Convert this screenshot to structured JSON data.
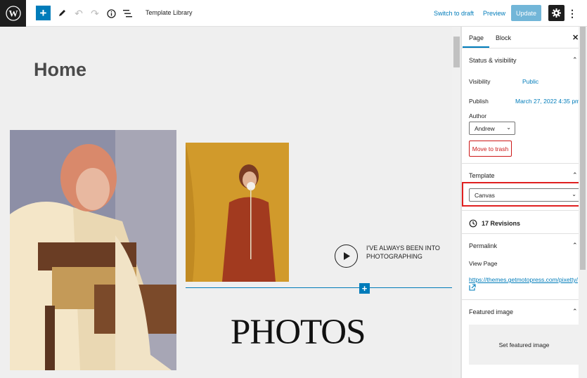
{
  "topbar": {
    "document_title": "Template Library",
    "switch_to_draft": "Switch to draft",
    "preview": "Preview",
    "update": "Update"
  },
  "canvas": {
    "page_title": "Home",
    "play_text": "I'VE ALWAYS BEEN INTO PHOTOGRAPHING",
    "photos_heading": "PHOTOS"
  },
  "sidebar": {
    "tabs": [
      "Page",
      "Block"
    ],
    "status": {
      "heading": "Status & visibility",
      "visibility_label": "Visibility",
      "visibility_value": "Public",
      "publish_label": "Publish",
      "publish_value": "March 27, 2022 4:35 pm",
      "author_label": "Author",
      "author_value": "Andrew",
      "trash": "Move to trash"
    },
    "template": {
      "heading": "Template",
      "value": "Canvas"
    },
    "revisions": "17 Revisions",
    "permalink": {
      "heading": "Permalink",
      "view_page": "View Page",
      "url": "https://themes.getmotopress.com/pixetty/"
    },
    "featured": {
      "heading": "Featured image",
      "set_label": "Set featured image"
    }
  },
  "colors": {
    "accent": "#007cba",
    "danger": "#cc1818",
    "highlight": "#e02020"
  }
}
